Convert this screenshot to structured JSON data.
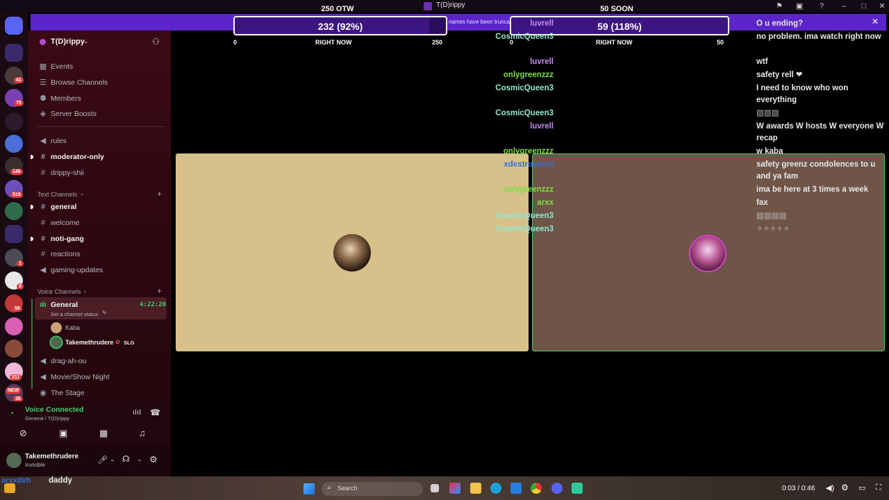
{
  "window": {
    "title": "T(D)rippy"
  },
  "banner": {
    "text": "names have been trunca"
  },
  "goals": [
    {
      "title": "250 OTW",
      "value": "232 (92%)",
      "fill": 0.92,
      "low": "0",
      "mid": "RIGHT NOW",
      "high": "250"
    },
    {
      "title": "50 SOON",
      "value": "59 (118%)",
      "fill": 1.0,
      "low": "0",
      "mid": "RIGHT NOW",
      "high": "50"
    }
  ],
  "server": {
    "name": "T(D)rippy"
  },
  "nav": [
    {
      "label": "Events",
      "icon": "calendar-icon"
    },
    {
      "label": "Browse Channels",
      "icon": "browse-channels-icon"
    },
    {
      "label": "Members",
      "icon": "members-icon"
    },
    {
      "label": "Server Boosts",
      "icon": "boost-icon"
    }
  ],
  "top_channels": [
    {
      "label": "rules",
      "bold": false
    },
    {
      "label": "moderator-only",
      "bold": true
    },
    {
      "label": "drippy-shii",
      "bold": false
    }
  ],
  "text_category": "Text Channels",
  "text_channels": [
    {
      "label": "general",
      "bold": true
    },
    {
      "label": "welcome",
      "bold": false
    },
    {
      "label": "noti-gang",
      "bold": true
    },
    {
      "label": "reactions",
      "bold": false
    },
    {
      "label": "gaming-updates",
      "bold": false
    }
  ],
  "voice_category": "Voice Channels",
  "voice_active": {
    "label": "General",
    "timer": "4:22:20",
    "status": "Set a channel status",
    "users": [
      "Kaba",
      "Takemethrudere",
      "SLG"
    ]
  },
  "voice_channels": [
    "drag-ah-ou",
    "Movie/Show Night",
    "The Stage"
  ],
  "voice_connected": {
    "title": "Voice Connected",
    "sub": "General / T(D)rippy"
  },
  "user": {
    "name": "Takemethrudere",
    "status": "Invisible"
  },
  "rail_badges": [
    "41",
    "75",
    "146",
    "519",
    "1",
    "8",
    "58",
    "211",
    "NEW",
    "36"
  ],
  "chat": [
    {
      "user": "luvrell",
      "color": "#c48cf4",
      "text": "O u ending?"
    },
    {
      "user": "CosmicQueen3",
      "color": "#8ee8d2",
      "text": "no problem. ima watch right now"
    },
    {
      "user": "luvrell",
      "color": "#c48cf4",
      "text": "wtf"
    },
    {
      "user": "onlygreenzzz",
      "color": "#7be03c",
      "text": "safety rell ❤"
    },
    {
      "user": "CosmicQueen3",
      "color": "#8ee8d2",
      "text": "I need to know who won everything"
    },
    {
      "user": "CosmicQueen3",
      "color": "#8ee8d2",
      "text": "▨▨▨"
    },
    {
      "user": "luvrell",
      "color": "#c48cf4",
      "text": "W awards W hosts W everyone W recap"
    },
    {
      "user": "onlygreenzzz",
      "color": "#7be03c",
      "text": "w kaba"
    },
    {
      "user": "xdestroyerxx",
      "color": "#2f6fe0",
      "text": "safety greenz condolences to u and ya fam"
    },
    {
      "user": "onlygreenzzz",
      "color": "#7be03c",
      "text": "ima be here at 3 times a week"
    },
    {
      "user": "arxx",
      "color": "#7be03c",
      "text": "fax"
    },
    {
      "user": "CosmicQueen3",
      "color": "#8ee8d2",
      "text": "▨▨▨▨"
    },
    {
      "user": "CosmicQueen3",
      "color": "#8ee8d2",
      "text": "✧✧✧✧✧"
    }
  ],
  "bottom_overlay": {
    "user": "arxxdxh",
    "text": "daddy"
  },
  "taskbar": {
    "search_placeholder": "Search",
    "time": "0:03 / 0:46"
  }
}
